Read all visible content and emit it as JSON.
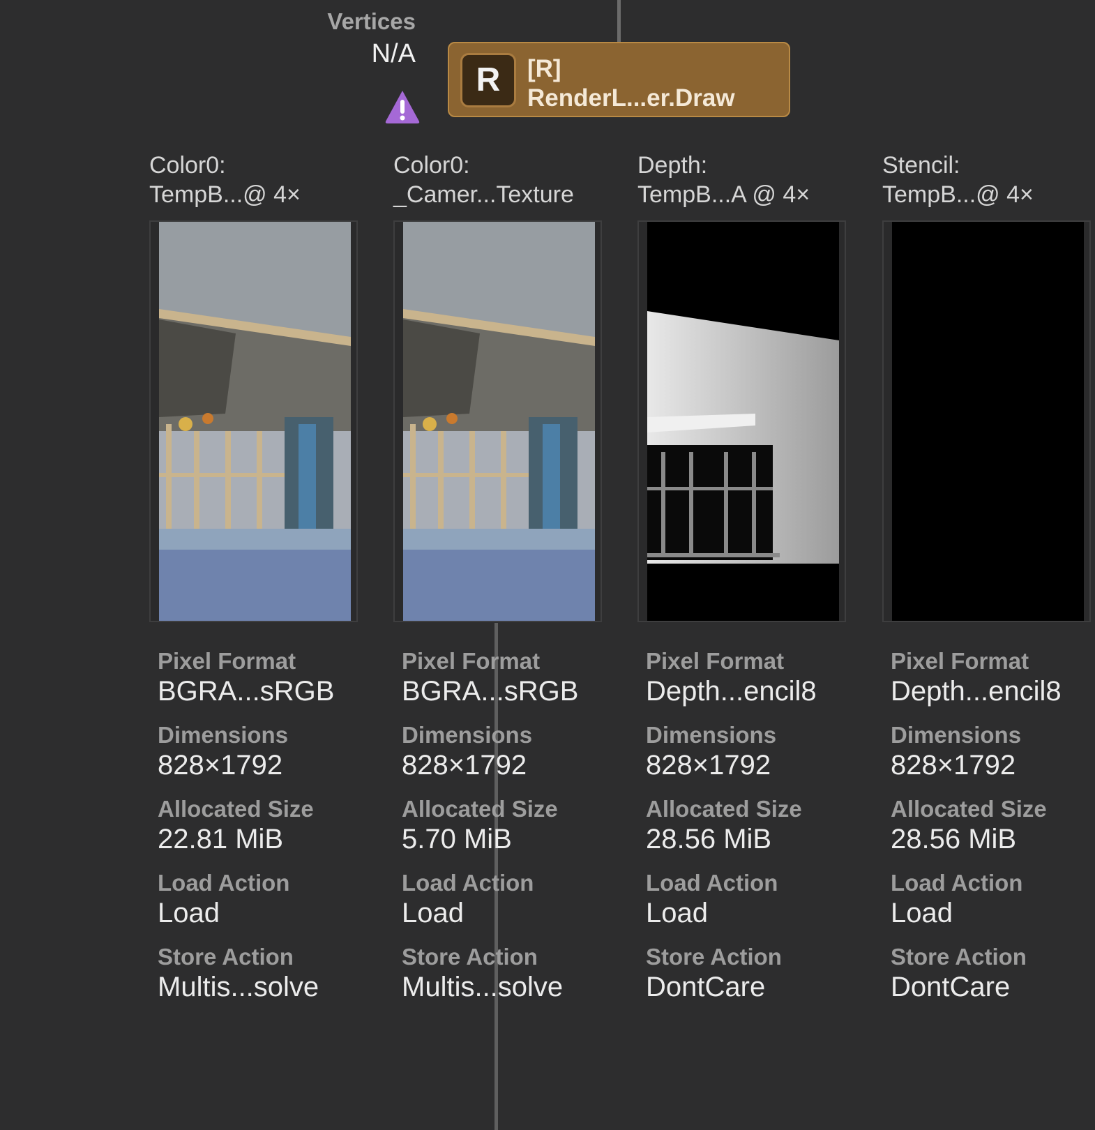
{
  "vertices": {
    "label": "Vertices",
    "value": "N/A"
  },
  "node": {
    "badge": "R",
    "line1": "[R]",
    "line2": "RenderL...er.Draw"
  },
  "attachments": [
    {
      "title_line1": "Color0:",
      "title_line2": "TempB...@ 4×",
      "props": [
        {
          "label": "Pixel Format",
          "value": "BGRA...sRGB"
        },
        {
          "label": "Dimensions",
          "value": "828×1792"
        },
        {
          "label": "Allocated Size",
          "value": "22.81 MiB"
        },
        {
          "label": "Load Action",
          "value": "Load"
        },
        {
          "label": "Store Action",
          "value": "Multis...solve"
        }
      ]
    },
    {
      "title_line1": "Color0:",
      "title_line2": "_Camer...Texture",
      "props": [
        {
          "label": "Pixel Format",
          "value": "BGRA...sRGB"
        },
        {
          "label": "Dimensions",
          "value": "828×1792"
        },
        {
          "label": "Allocated Size",
          "value": "5.70 MiB"
        },
        {
          "label": "Load Action",
          "value": "Load"
        },
        {
          "label": "Store Action",
          "value": "Multis...solve"
        }
      ]
    },
    {
      "title_line1": "Depth:",
      "title_line2": "TempB...A @ 4×",
      "props": [
        {
          "label": "Pixel Format",
          "value": "Depth...encil8"
        },
        {
          "label": "Dimensions",
          "value": "828×1792"
        },
        {
          "label": "Allocated Size",
          "value": "28.56 MiB"
        },
        {
          "label": "Load Action",
          "value": "Load"
        },
        {
          "label": "Store Action",
          "value": "DontCare"
        }
      ]
    },
    {
      "title_line1": "Stencil:",
      "title_line2": "TempB...@ 4×",
      "props": [
        {
          "label": "Pixel Format",
          "value": "Depth...encil8"
        },
        {
          "label": "Dimensions",
          "value": "828×1792"
        },
        {
          "label": "Allocated Size",
          "value": "28.56 MiB"
        },
        {
          "label": "Load Action",
          "value": "Load"
        },
        {
          "label": "Store Action",
          "value": "DontCare"
        }
      ]
    }
  ]
}
